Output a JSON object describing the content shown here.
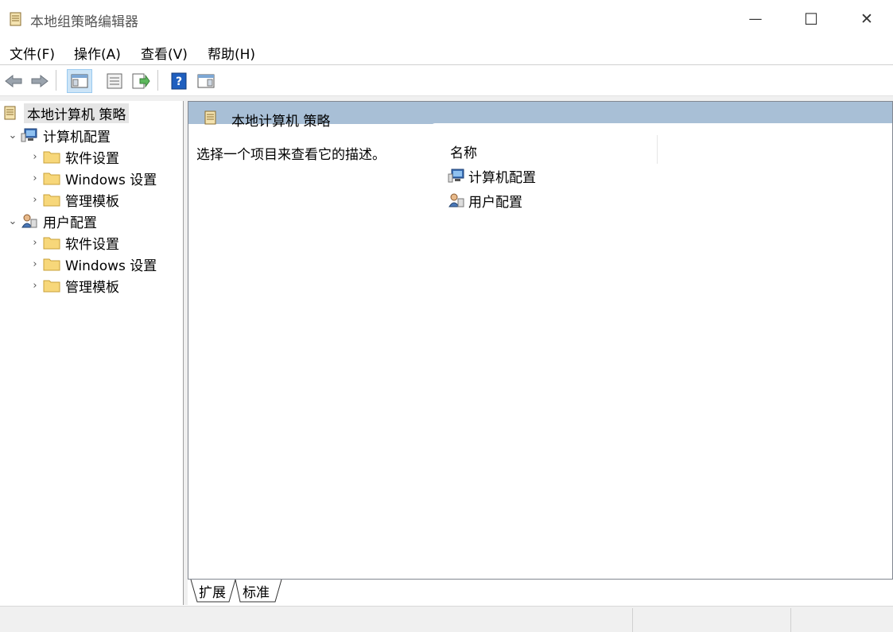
{
  "window": {
    "title": "本地组策略编辑器",
    "controls": {
      "minimize": "—",
      "maximize": "☐",
      "close": "✕"
    }
  },
  "menu": [
    "文件(F)",
    "操作(A)",
    "查看(V)",
    "帮助(H)"
  ],
  "toolbar": {
    "buttons": [
      "back-icon",
      "forward-icon",
      "show-hide-console-tree-icon",
      "properties-icon",
      "export-list-icon",
      "help-icon",
      "show-hide-action-pane-icon"
    ],
    "active": "show-hide-console-tree-icon"
  },
  "tree": {
    "root": "本地计算机 策略",
    "computer": {
      "label": "计算机配置",
      "children": [
        "软件设置",
        "Windows 设置",
        "管理模板"
      ]
    },
    "user": {
      "label": "用户配置",
      "children": [
        "软件设置",
        "Windows 设置",
        "管理模板"
      ]
    }
  },
  "detail": {
    "header_title": "本地计算机 策略",
    "description": "选择一个项目来查看它的描述。",
    "column_name": "名称",
    "items": [
      "计算机配置",
      "用户配置"
    ]
  },
  "tabs": [
    "扩展",
    "标准"
  ],
  "colors": {
    "header_band": "#a8bfd6",
    "selection": "#e5e5e5",
    "toolbar_active": "#cce4f7"
  }
}
